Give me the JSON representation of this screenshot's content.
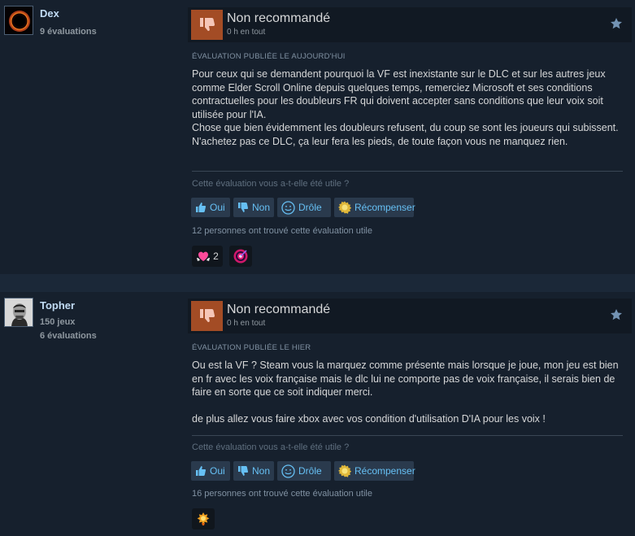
{
  "colors": {
    "page_bg": "#1b2838",
    "review_bg": "#16202d",
    "thumb_down_bg": "#a34c25",
    "link_blue": "#66c0f4",
    "author_name": "#c1dbf4"
  },
  "reviews": [
    {
      "author": {
        "name": "Dex",
        "products_owned": "",
        "reviews_count": "9 évaluations",
        "avatar_icon": "dark-planet-avatar"
      },
      "verdict": "Non recommandé",
      "verdict_icon": "thumbs-down-icon",
      "hours": "0 h en tout",
      "posted": "Évaluation publiée le aujourd'hui",
      "paragraphs": [
        "Pour ceux qui se demandent pourquoi la VF est inexistante sur le DLC et sur les autres jeux comme Elder Scroll Online depuis quelques temps, remerciez Microsoft et ses conditions contractuelles pour les doubleurs FR qui doivent accepter sans conditions que leur voix soit utilisée pour l'IA.",
        "Chose que bien évidemment les doubleurs refusent, du coup se sont les joueurs qui subissent.",
        "N'achetez pas ce DLC, ça leur fera les pieds, de toute façon vous ne manquez rien."
      ],
      "helpful_question": "Cette évaluation vous a-t-elle été utile ?",
      "buttons": {
        "yes": "Oui",
        "no": "Non",
        "funny": "Drôle",
        "award": "Récompenser"
      },
      "helpful_count": "12 personnes ont trouvé cette évaluation utile",
      "awards": [
        {
          "icon": "heart-hands-award-icon",
          "count": "2"
        },
        {
          "icon": "bullseye-award-icon",
          "count": ""
        }
      ]
    },
    {
      "author": {
        "name": "Topher",
        "products_owned": "150 jeux",
        "reviews_count": "6 évaluations",
        "avatar_icon": "masked-face-avatar"
      },
      "verdict": "Non recommandé",
      "verdict_icon": "thumbs-down-icon",
      "hours": "0 h en tout",
      "posted": "Évaluation publiée le hier",
      "paragraphs": [
        "Ou est la VF ? Steam vous la marquez comme présente mais lorsque je joue, mon jeu est bien en fr avec les voix française mais le dlc lui ne comporte pas de voix française, il serais bien de faire en sorte que ce soit indiquer merci.",
        "",
        "de plus allez vous faire xbox avec vos condition d'utilisation D'IA pour les voix !"
      ],
      "helpful_question": "Cette évaluation vous a-t-elle été utile ?",
      "buttons": {
        "yes": "Oui",
        "no": "Non",
        "funny": "Drôle",
        "award": "Récompenser"
      },
      "helpful_count": "16 personnes ont trouvé cette évaluation utile",
      "awards": [
        {
          "icon": "golden-burst-award-icon",
          "count": ""
        }
      ]
    }
  ]
}
